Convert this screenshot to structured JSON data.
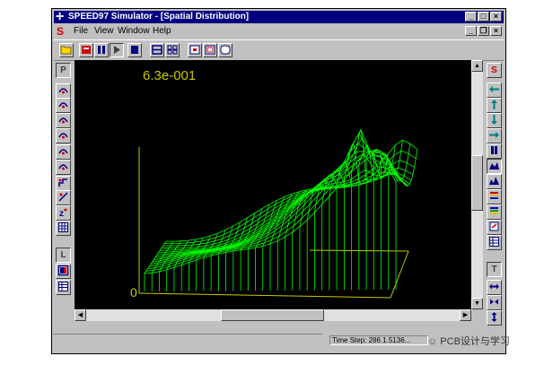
{
  "window": {
    "title": "SPEED97 Simulator - [Spatial Distribution]",
    "title_icon": "crosshair-icon",
    "caption_buttons": [
      "minimize",
      "maximize",
      "close"
    ]
  },
  "menubar": {
    "logo": "S",
    "items": [
      {
        "label": "File"
      },
      {
        "label": "View"
      },
      {
        "label": "Window"
      },
      {
        "label": "Help"
      }
    ]
  },
  "toolbar": {
    "buttons": [
      {
        "name": "open-icon",
        "glyph": "📂"
      },
      {
        "name": "record-icon",
        "glyph": "■"
      },
      {
        "name": "pause-icon",
        "glyph": "❚❚"
      },
      {
        "name": "play-icon",
        "glyph": "▶"
      },
      {
        "name": "stop-icon",
        "glyph": "■"
      },
      {
        "name": "grid-view-icon",
        "glyph": "☷"
      },
      {
        "name": "tile-view-icon",
        "glyph": "⊞"
      },
      {
        "name": "zoom-a-icon",
        "glyph": "⊡"
      },
      {
        "name": "zoom-b-icon",
        "glyph": "⊡"
      },
      {
        "name": "zoom-c-icon",
        "glyph": "▢"
      }
    ]
  },
  "left_panel": {
    "header_p": "P",
    "header_l": "L"
  },
  "right_panel": {
    "header_s": "S",
    "header_t": "T"
  },
  "plot": {
    "value_label": "6.3e-001",
    "origin_label": "0",
    "accent": "#00ff00",
    "axis_color": "#c8c800"
  },
  "statusbar": {
    "time_step_label": "Time Step: 286  1.5136..."
  },
  "watermark": {
    "text": "PCB设计与学习"
  }
}
